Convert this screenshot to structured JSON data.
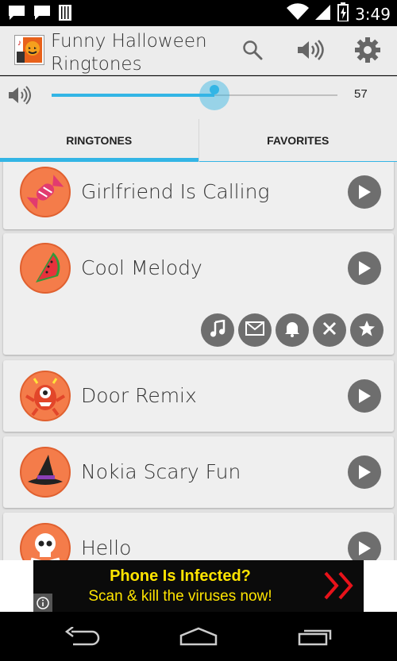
{
  "status_bar": {
    "time": "3:49",
    "left_icons": [
      "chat-icon",
      "chat-icon",
      "barcode-icon"
    ],
    "right_icons": [
      "wifi-icon",
      "signal-icon",
      "battery-charging-icon"
    ]
  },
  "action_bar": {
    "title": "Funny Halloween Ringtones",
    "app_icon": "app-logo-icon",
    "actions": [
      "search-icon",
      "volume-icon",
      "settings-icon"
    ]
  },
  "volume": {
    "icon": "volume-icon",
    "value": 57,
    "value_label": "57",
    "fill_fraction": 0.57
  },
  "tabs": [
    {
      "label": "RINGTONES",
      "active": true
    },
    {
      "label": "FAVORITES",
      "active": false
    }
  ],
  "ringtones": [
    {
      "title": "Girlfriend Is Calling",
      "icon": "candy-icon",
      "expanded": false
    },
    {
      "title": "Cool Melody",
      "icon": "melon-icon",
      "expanded": true
    },
    {
      "title": "Door Remix",
      "icon": "monster-icon",
      "expanded": false
    },
    {
      "title": "Nokia Scary Fun",
      "icon": "witch-hat-icon",
      "expanded": false
    },
    {
      "title": "Hello",
      "icon": "skull-icon",
      "expanded": false
    }
  ],
  "expanded_actions": [
    "music-note-icon",
    "email-icon",
    "bell-icon",
    "close-icon",
    "star-icon"
  ],
  "ad": {
    "line1": "Phone Is Infected?",
    "line2": "Scan & kill the viruses now!",
    "text_color": "#ffe500",
    "arrow_color": "#e8121a"
  },
  "nav_bar": [
    "back-icon",
    "home-icon",
    "recent-apps-icon"
  ],
  "colors": {
    "accent": "#33b5e5",
    "avatar_bg": "#f47c4a",
    "button_gray": "#6e6e6e"
  }
}
